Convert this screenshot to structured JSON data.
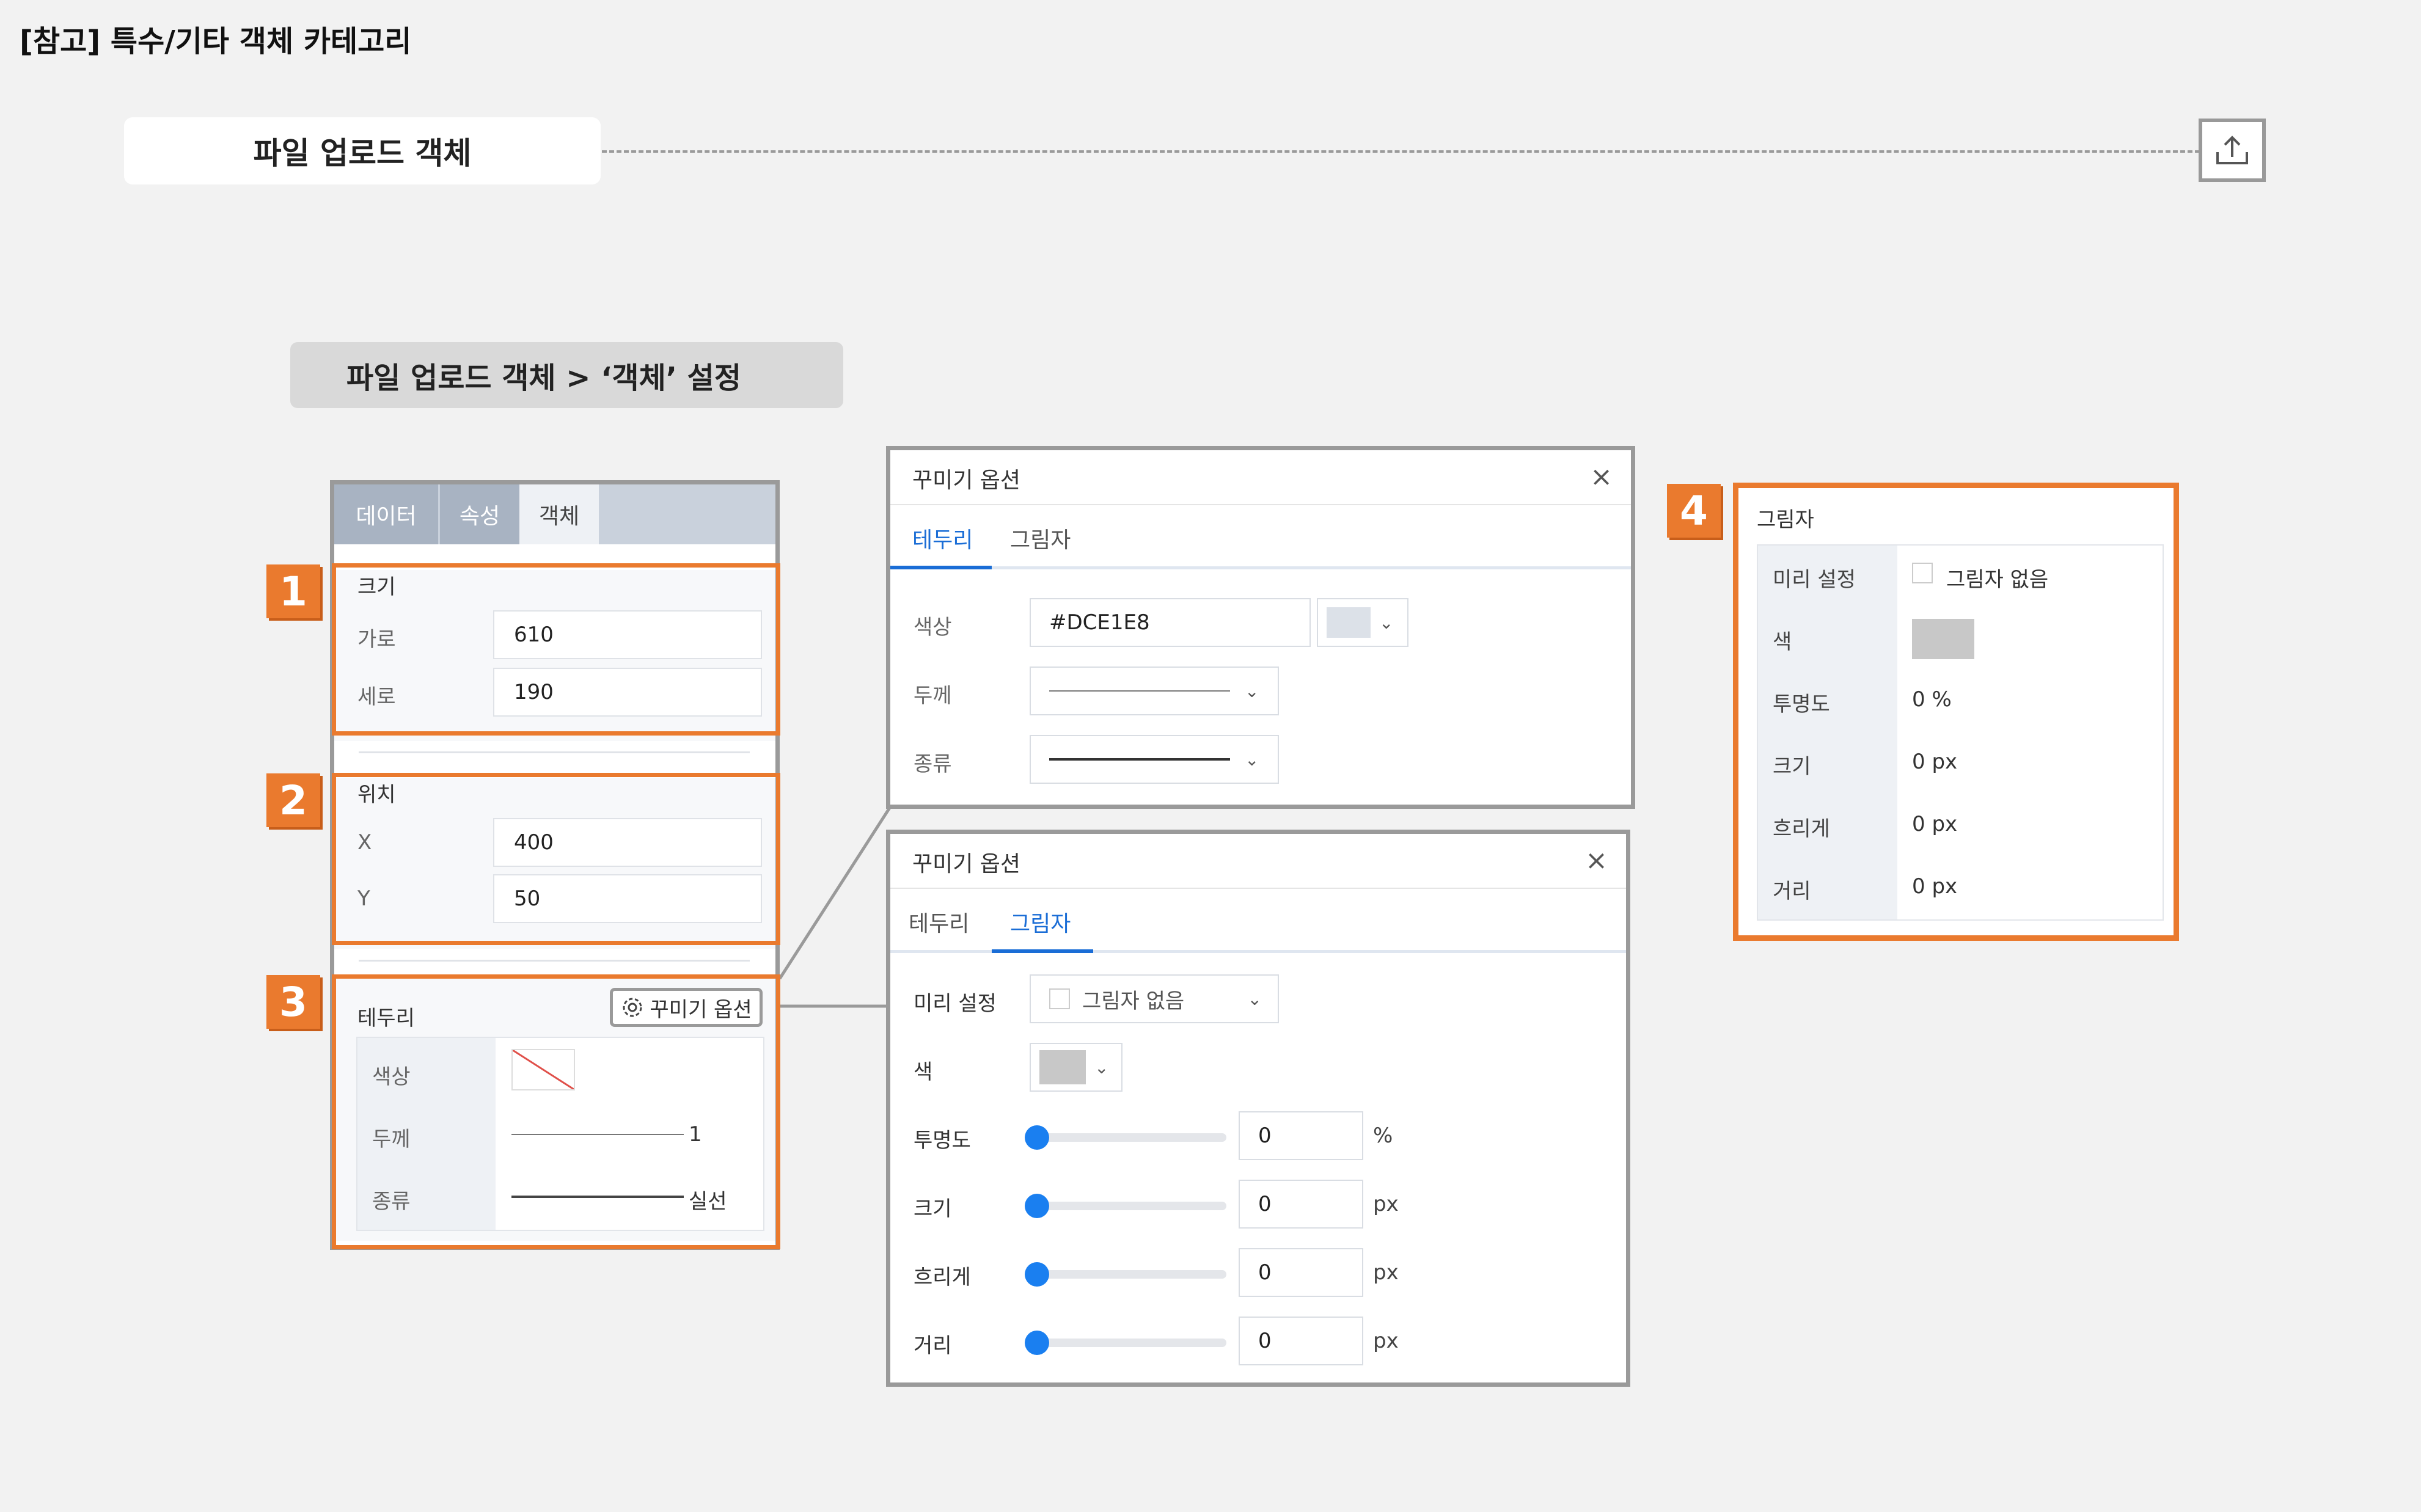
{
  "page": {
    "title": "[참고] 특수/기타 객체 카테고리",
    "object_label": "파일 업로드 객체",
    "breadcrumb": "파일 업로드 객체 > ‘객체’ 설정"
  },
  "panel": {
    "tabs": [
      "데이터",
      "속성",
      "객체"
    ],
    "size": {
      "heading": "크기",
      "width_label": "가로",
      "width_value": "610",
      "height_label": "세로",
      "height_value": "190"
    },
    "position": {
      "heading": "위치",
      "x_label": "X",
      "x_value": "400",
      "y_label": "Y",
      "y_value": "50"
    },
    "border": {
      "heading": "테두리",
      "options_button": "꾸미기 옵션",
      "color_label": "색상",
      "thickness_label": "두께",
      "thickness_value": "1",
      "type_label": "종류",
      "type_value": "실선"
    }
  },
  "markers": [
    "1",
    "2",
    "3",
    "4"
  ],
  "dialog_border": {
    "title": "꾸미기 옵션",
    "close": "×",
    "tabs": [
      "테두리",
      "그림자"
    ],
    "color_label": "색상",
    "color_value": "#DCE1E8",
    "thickness_label": "두께",
    "type_label": "종류"
  },
  "dialog_shadow": {
    "title": "꾸미기 옵션",
    "close": "×",
    "tabs": [
      "테두리",
      "그림자"
    ],
    "preset_label": "미리 설정",
    "preset_value": "그림자 없음",
    "color_label": "색",
    "opacity_label": "투명도",
    "opacity_value": "0",
    "opacity_unit": "%",
    "size_label": "크기",
    "size_value": "0",
    "size_unit": "px",
    "blur_label": "흐리게",
    "blur_value": "0",
    "blur_unit": "px",
    "distance_label": "거리",
    "distance_value": "0",
    "distance_unit": "px"
  },
  "shadow_panel": {
    "heading": "그림자",
    "preset_label": "미리 설정",
    "preset_value": "그림자 없음",
    "color_label": "색",
    "opacity_label": "투명도",
    "opacity_value": "0 %",
    "size_label": "크기",
    "size_value": "0 px",
    "blur_label": "흐리게",
    "blur_value": "0 px",
    "distance_label": "거리",
    "distance_value": "0 px"
  },
  "colors": {
    "accent_orange": "#ea7a2e",
    "active_blue": "#1a6dd6",
    "slider_blue": "#1a7ff0"
  }
}
